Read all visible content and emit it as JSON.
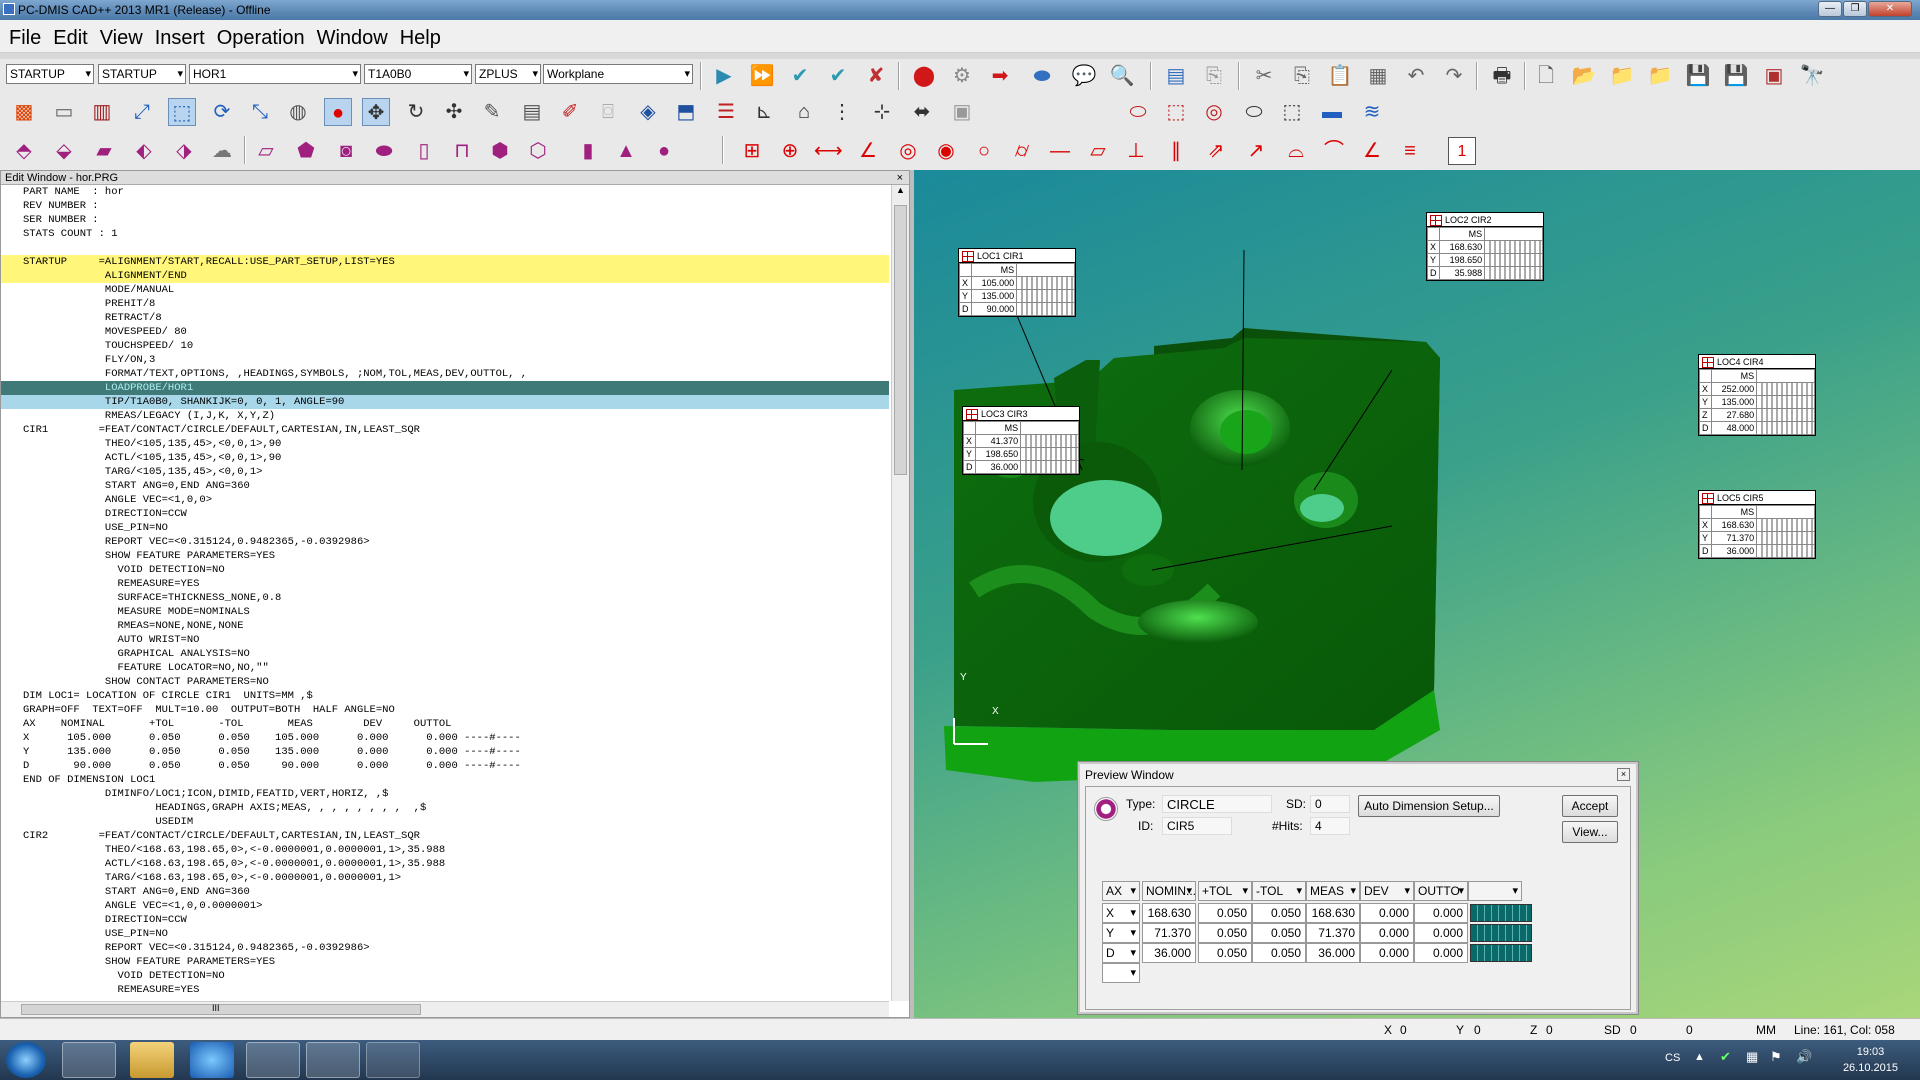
{
  "window": {
    "title": "PC-DMIS CAD++ 2013 MR1 (Release) - Offline"
  },
  "menu": [
    "File",
    "Edit",
    "View",
    "Insert",
    "Operation",
    "Window",
    "Help"
  ],
  "toolbar": {
    "combos": [
      "STARTUP",
      "STARTUP",
      "HOR1",
      "T1A0B0",
      "ZPLUS",
      "Workplane"
    ]
  },
  "edit_window": {
    "title": "Edit Window - hor.PRG",
    "lines": [
      {
        "t": "PART NAME  : hor",
        "c": ""
      },
      {
        "t": "REV NUMBER :",
        "c": ""
      },
      {
        "t": "SER NUMBER :",
        "c": ""
      },
      {
        "t": "STATS COUNT : 1",
        "c": ""
      },
      {
        "t": "",
        "c": ""
      },
      {
        "t": "STARTUP     =ALIGNMENT/START,RECALL:USE_PART_SETUP,LIST=YES",
        "c": "ylw"
      },
      {
        "t": "             ALIGNMENT/END",
        "c": "ylw"
      },
      {
        "t": "             MODE/MANUAL",
        "c": ""
      },
      {
        "t": "             PREHIT/8",
        "c": ""
      },
      {
        "t": "             RETRACT/8",
        "c": ""
      },
      {
        "t": "             MOVESPEED/ 80",
        "c": ""
      },
      {
        "t": "             TOUCHSPEED/ 10",
        "c": ""
      },
      {
        "t": "             FLY/ON,3",
        "c": ""
      },
      {
        "t": "             FORMAT/TEXT,OPTIONS, ,HEADINGS,SYMBOLS, ;NOM,TOL,MEAS,DEV,OUTTOL, ,",
        "c": ""
      },
      {
        "t": "             LOADPROBE/HOR1",
        "c": "sel"
      },
      {
        "t": "             TIP/T1A0B0, SHANKIJK=0, 0, 1, ANGLE=90",
        "c": "sel2"
      },
      {
        "t": "             RMEAS/LEGACY (I,J,K, X,Y,Z)",
        "c": ""
      },
      {
        "t": "CIR1        =FEAT/CONTACT/CIRCLE/DEFAULT,CARTESIAN,IN,LEAST_SQR",
        "c": ""
      },
      {
        "t": "             THEO/<105,135,45>,<0,0,1>,90",
        "c": ""
      },
      {
        "t": "             ACTL/<105,135,45>,<0,0,1>,90",
        "c": ""
      },
      {
        "t": "             TARG/<105,135,45>,<0,0,1>",
        "c": ""
      },
      {
        "t": "             START ANG=0,END ANG=360",
        "c": ""
      },
      {
        "t": "             ANGLE VEC=<1,0,0>",
        "c": ""
      },
      {
        "t": "             DIRECTION=CCW",
        "c": ""
      },
      {
        "t": "             USE_PIN=NO",
        "c": ""
      },
      {
        "t": "             REPORT VEC=<0.315124,0.9482365,-0.0392986>",
        "c": ""
      },
      {
        "t": "             SHOW FEATURE PARAMETERS=YES",
        "c": ""
      },
      {
        "t": "               VOID DETECTION=NO",
        "c": ""
      },
      {
        "t": "               REMEASURE=YES",
        "c": ""
      },
      {
        "t": "               SURFACE=THICKNESS_NONE,0.8",
        "c": ""
      },
      {
        "t": "               MEASURE MODE=NOMINALS",
        "c": ""
      },
      {
        "t": "               RMEAS=NONE,NONE,NONE",
        "c": ""
      },
      {
        "t": "               AUTO WRIST=NO",
        "c": ""
      },
      {
        "t": "               GRAPHICAL ANALYSIS=NO",
        "c": ""
      },
      {
        "t": "               FEATURE LOCATOR=NO,NO,\"\"",
        "c": ""
      },
      {
        "t": "             SHOW CONTACT PARAMETERS=NO",
        "c": ""
      },
      {
        "t": "DIM LOC1= LOCATION OF CIRCLE CIR1  UNITS=MM ,$",
        "c": ""
      },
      {
        "t": "GRAPH=OFF  TEXT=OFF  MULT=10.00  OUTPUT=BOTH  HALF ANGLE=NO",
        "c": ""
      },
      {
        "t": "AX    NOMINAL       +TOL       -TOL       MEAS        DEV     OUTTOL",
        "c": ""
      },
      {
        "t": "X      105.000      0.050      0.050    105.000      0.000      0.000 ----#----",
        "c": ""
      },
      {
        "t": "Y      135.000      0.050      0.050    135.000      0.000      0.000 ----#----",
        "c": ""
      },
      {
        "t": "D       90.000      0.050      0.050     90.000      0.000      0.000 ----#----",
        "c": ""
      },
      {
        "t": "END OF DIMENSION LOC1",
        "c": ""
      },
      {
        "t": "             DIMINFO/LOC1;ICON,DIMID,FEATID,VERT,HORIZ, ,$",
        "c": ""
      },
      {
        "t": "                     HEADINGS,GRAPH AXIS;MEAS, , , , , , , ,  ,$",
        "c": ""
      },
      {
        "t": "                     USEDIM",
        "c": ""
      },
      {
        "t": "CIR2        =FEAT/CONTACT/CIRCLE/DEFAULT,CARTESIAN,IN,LEAST_SQR",
        "c": ""
      },
      {
        "t": "             THEO/<168.63,198.65,0>,<-0.0000001,0.0000001,1>,35.988",
        "c": ""
      },
      {
        "t": "             ACTL/<168.63,198.65,0>,<-0.0000001,0.0000001,1>,35.988",
        "c": ""
      },
      {
        "t": "             TARG/<168.63,198.65,0>,<-0.0000001,0.0000001,1>",
        "c": ""
      },
      {
        "t": "             START ANG=0,END ANG=360",
        "c": ""
      },
      {
        "t": "             ANGLE VEC=<1,0,0.0000001>",
        "c": ""
      },
      {
        "t": "             DIRECTION=CCW",
        "c": ""
      },
      {
        "t": "             USE_PIN=NO",
        "c": ""
      },
      {
        "t": "             REPORT VEC=<0.315124,0.9482365,-0.0392986>",
        "c": ""
      },
      {
        "t": "             SHOW FEATURE PARAMETERS=YES",
        "c": ""
      },
      {
        "t": "               VOID DETECTION=NO",
        "c": ""
      },
      {
        "t": "               REMEASURE=YES",
        "c": ""
      }
    ],
    "hscroll_text": "III"
  },
  "labels": [
    {
      "title": "LOC1 CIR1",
      "rows": [
        [
          "X",
          "105.000"
        ],
        [
          "Y",
          "135.000"
        ],
        [
          "D",
          "90.000"
        ]
      ]
    },
    {
      "title": "LOC2 CIR2",
      "rows": [
        [
          "X",
          "168.630"
        ],
        [
          "Y",
          "198.650"
        ],
        [
          "D",
          "35.988"
        ]
      ]
    },
    {
      "title": "LOC3 CIR3",
      "rows": [
        [
          "X",
          "41.370"
        ],
        [
          "Y",
          "198.650"
        ],
        [
          "D",
          "36.000"
        ]
      ]
    },
    {
      "title": "LOC4 CIR4",
      "rows": [
        [
          "X",
          "252.000"
        ],
        [
          "Y",
          "135.000"
        ],
        [
          "Z",
          "27.680"
        ],
        [
          "D",
          "48.000"
        ]
      ]
    },
    {
      "title": "LOC5 CIR5",
      "rows": [
        [
          "X",
          "168.630"
        ],
        [
          "Y",
          "71.370"
        ],
        [
          "D",
          "36.000"
        ]
      ]
    }
  ],
  "label_ms": "MS",
  "preview": {
    "title": "Preview Window",
    "type_label": "Type:",
    "type_value": "CIRCLE",
    "id_label": "ID:",
    "id_value": "CIR5",
    "sd_label": "SD:",
    "sd_value": "0",
    "hits_label": "#Hits:",
    "hits_value": "4",
    "auto_dim_button": "Auto Dimension Setup...",
    "accept_button": "Accept",
    "view_button": "View...",
    "headers": [
      "AX",
      "NOMIN...",
      "+TOL",
      "-TOL",
      "MEAS",
      "DEV",
      "OUTTO",
      ""
    ],
    "rows": [
      [
        "X",
        "168.630",
        "0.050",
        "0.050",
        "168.630",
        "0.000",
        "0.000"
      ],
      [
        "Y",
        "71.370",
        "0.050",
        "0.050",
        "71.370",
        "0.000",
        "0.000"
      ],
      [
        "D",
        "36.000",
        "0.050",
        "0.050",
        "36.000",
        "0.000",
        "0.000"
      ]
    ]
  },
  "status": {
    "x_label": "X",
    "x": "0",
    "y_label": "Y",
    "y": "0",
    "z_label": "Z",
    "z": "0",
    "sd_label": "SD",
    "sd": "0",
    "sd2": "0",
    "units": "MM",
    "position": "Line: 161, Col: 058"
  },
  "taskbar": {
    "lang": "CS",
    "time": "19:03",
    "date": "26.10.2015"
  },
  "axes": {
    "x": "X",
    "y": "Y"
  }
}
